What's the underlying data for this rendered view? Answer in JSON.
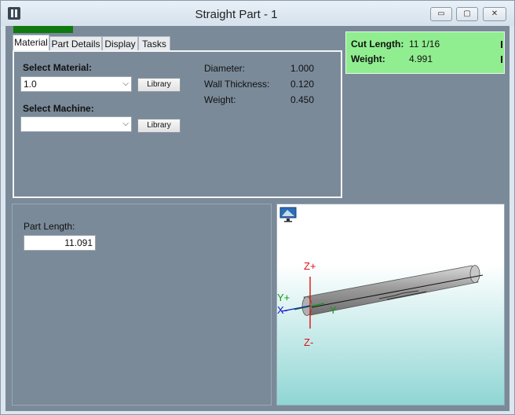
{
  "window": {
    "title": "Straight Part - 1",
    "controls": {
      "minimize": "▭",
      "maximize": "▢",
      "close": "✕"
    }
  },
  "progress": {
    "value": 1.0,
    "color": "#0f7a0f"
  },
  "tabs": [
    {
      "label": "Material",
      "active": true
    },
    {
      "label": "Part Details",
      "active": false
    },
    {
      "label": "Display",
      "active": false
    },
    {
      "label": "Tasks",
      "active": false
    }
  ],
  "material_tab": {
    "select_material_label": "Select Material:",
    "material_value": "1.0",
    "material_library_button": "Library",
    "select_machine_label": "Select Machine:",
    "machine_value": "",
    "machine_library_button": "Library",
    "properties": [
      {
        "label": "Diameter:",
        "value": "1.000"
      },
      {
        "label": "Wall Thickness:",
        "value": "0.120"
      },
      {
        "label": "Weight:",
        "value": "0.450"
      }
    ]
  },
  "summary": {
    "cut_length_label": "Cut Length:",
    "cut_length_value": "11 1/16",
    "weight_label": "Weight:",
    "weight_value": "4.991",
    "background": "#90ee90"
  },
  "part_length": {
    "label": "Part Length:",
    "value": "11.091"
  },
  "viewport": {
    "axes": {
      "z_plus": "Z+",
      "z_minus": "Z-",
      "y_plus": "Y+",
      "x_minus": "X-",
      "y": "Y"
    },
    "colors": {
      "z": "#e01010",
      "y": "#119911",
      "x": "#1010cc"
    },
    "view_icon": "camera-view-icon"
  }
}
